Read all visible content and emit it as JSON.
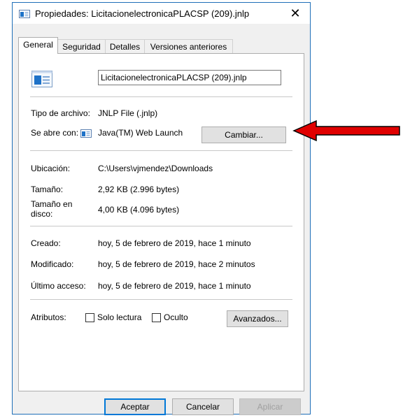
{
  "window": {
    "title": "Propiedades: LicitacionelectronicaPLACSP (209).jnlp",
    "close_glyph": "✕"
  },
  "tabs": [
    {
      "label": "General",
      "active": true
    },
    {
      "label": "Seguridad",
      "active": false
    },
    {
      "label": "Detalles",
      "active": false
    },
    {
      "label": "Versiones anteriores",
      "active": false
    }
  ],
  "general": {
    "file_name": "LicitacionelectronicaPLACSP (209).jnlp",
    "tipo_label": "Tipo de archivo:",
    "tipo_value": "JNLP File (.jnlp)",
    "abre_label": "Se abre con:",
    "abre_value": "Java(TM) Web Launch",
    "cambiar_label": "Cambiar...",
    "ubicacion_label": "Ubicación:",
    "ubicacion_value": "C:\\Users\\vjmendez\\Downloads",
    "tamano_label": "Tamaño:",
    "tamano_value": "2,92 KB (2.996 bytes)",
    "tamano_disco_label_1": "Tamaño en",
    "tamano_disco_label_2": "disco:",
    "tamano_disco_value": "4,00 KB (4.096 bytes)",
    "creado_label": "Creado:",
    "creado_value": "hoy, 5 de febrero de 2019, hace 1 minuto",
    "modificado_label": "Modificado:",
    "modificado_value": "hoy, 5 de febrero de 2019, hace 2 minutos",
    "acceso_label": "Último acceso:",
    "acceso_value": "hoy, 5 de febrero de 2019, hace 1 minuto",
    "atributos_label": "Atributos:",
    "solo_lectura_label": "Solo lectura",
    "oculto_label": "Oculto",
    "avanzados_label": "Avanzados..."
  },
  "footer": {
    "aceptar": "Aceptar",
    "cancelar": "Cancelar",
    "aplicar": "Aplicar"
  },
  "colors": {
    "arrow": "#e00000",
    "accent": "#0078d7",
    "file_icon": "#1e72c8"
  }
}
